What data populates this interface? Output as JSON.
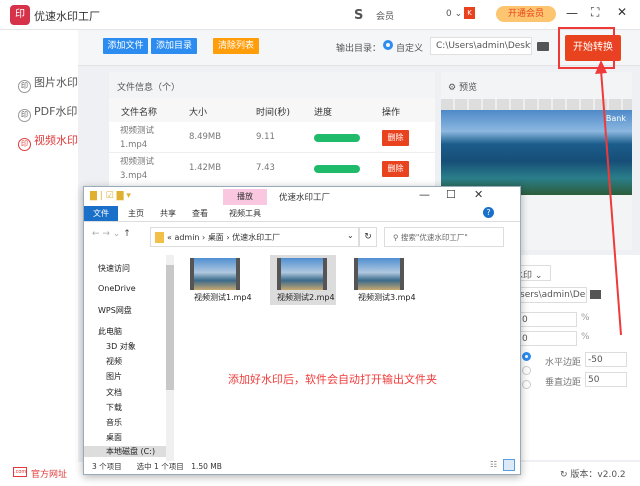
{
  "app": {
    "title": "优速水印工厂",
    "logo": "印",
    "user_label": "会员",
    "count": "0 ⌄",
    "vip_button": "开通会员"
  },
  "sidebar": {
    "items": [
      {
        "label": "图片水印",
        "active": false
      },
      {
        "label": "PDF水印",
        "active": false
      },
      {
        "label": "视频水印",
        "active": true
      }
    ]
  },
  "toolbar": {
    "add_file": "添加文件",
    "add_dir": "添加目录",
    "clear_list": "清除列表",
    "output_label": "输出目录：",
    "custom_label": "自定义",
    "output_path": "C:\\Users\\admin\\Deskto",
    "start": "开始转换"
  },
  "file_panel": {
    "title": "文件信息（个）",
    "columns": [
      "文件名称",
      "大小",
      "时间(秒)",
      "进度",
      "操作"
    ],
    "rows": [
      {
        "name": "视频测试1.mp4",
        "size": "8.49MB",
        "time": "9.11",
        "progress": 100,
        "action": "删除"
      },
      {
        "name": "视频测试3.mp4",
        "size": "1.42MB",
        "time": "7.43",
        "progress": 100,
        "action": "删除"
      }
    ]
  },
  "preview": {
    "title": "预览",
    "watermark": "Bank"
  },
  "settings": {
    "watermark_type": "水印 ⌄",
    "path": "sers\\admin\\Des",
    "val1": "0",
    "val2": "0",
    "unit": "%",
    "h_margin_label": "水平边距",
    "h_margin": "-50",
    "v_margin_label": "垂直边距",
    "v_margin": "50"
  },
  "explorer": {
    "title": "优速水印工厂",
    "context_tab": "播放",
    "tabs": [
      "文件",
      "主页",
      "共享",
      "查看",
      "视频工具"
    ],
    "breadcrumb": [
      "admin",
      "桌面",
      "优速水印工厂"
    ],
    "search_placeholder": "搜索\"优速水印工厂\"",
    "nav": [
      "快速访问",
      "OneDrive",
      "WPS网盘",
      "此电脑",
      "3D 对象",
      "视频",
      "图片",
      "文档",
      "下载",
      "音乐",
      "桌面",
      "本地磁盘 (C:)"
    ],
    "files": [
      "视频测试1.mp4",
      "视频测试2.mp4",
      "视频测试3.mp4"
    ],
    "status": {
      "count": "3 个项目",
      "selected": "选中 1 个项目",
      "size": "1.50 MB"
    }
  },
  "annotation": "添加好水印后，软件会自动打开输出文件夹",
  "footer": {
    "website": "官方网址",
    "version": "版本：v2.0.2"
  }
}
